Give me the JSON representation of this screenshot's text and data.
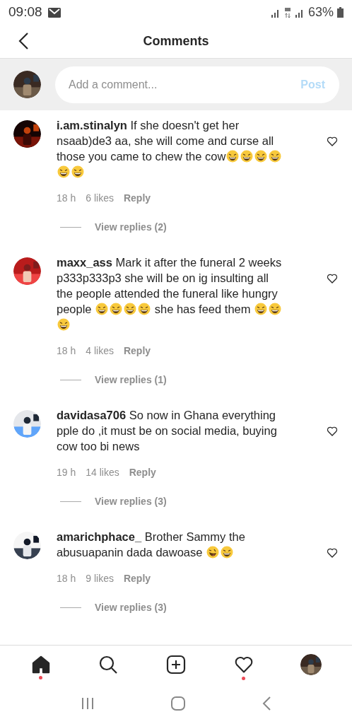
{
  "status_bar": {
    "time": "09:08",
    "battery": "63%"
  },
  "header": {
    "title": "Comments"
  },
  "composer": {
    "placeholder": "Add a comment...",
    "post": "Post",
    "disabled": true
  },
  "comments": [
    {
      "user": "i.am.stinalyn",
      "liked": false,
      "body": [
        {
          "kind": "text",
          "text": "If she doesn't get her nsaab)de3 aa, she will come and curse all those you came to chew the cow"
        },
        {
          "kind": "laugh"
        },
        {
          "kind": "laugh"
        },
        {
          "kind": "laugh"
        },
        {
          "kind": "laugh"
        },
        {
          "kind": "laugh"
        },
        {
          "kind": "laugh"
        }
      ],
      "time": "18 h",
      "likes": "6 likes",
      "reply": "Reply",
      "view_replies": "View replies (2)"
    },
    {
      "user": "maxx_ass",
      "liked": false,
      "body": [
        {
          "kind": "text",
          "text": "Mark it after the funeral 2 weeks p333p333p3 she will be on ig insulting all the people attended the funeral like hungry people "
        },
        {
          "kind": "laugh"
        },
        {
          "kind": "laugh"
        },
        {
          "kind": "laugh"
        },
        {
          "kind": "laugh"
        },
        {
          "kind": "text",
          "text": " she has feed them "
        },
        {
          "kind": "laugh"
        },
        {
          "kind": "laugh"
        },
        {
          "kind": "laugh"
        }
      ],
      "time": "18 h",
      "likes": "4 likes",
      "reply": "Reply",
      "view_replies": "View replies (1)"
    },
    {
      "user": "davidasa706",
      "liked": false,
      "body": [
        {
          "kind": "text",
          "text": "So now in Ghana everything pple do ,it must be on social media, buying cow too bi news"
        }
      ],
      "time": "19 h",
      "likes": "14 likes",
      "reply": "Reply",
      "view_replies": "View replies (3)"
    },
    {
      "user": "amarichphace_",
      "liked": false,
      "body": [
        {
          "kind": "text",
          "text": "Brother Sammy the abusuapanin dada dawoase "
        },
        {
          "kind": "wink"
        },
        {
          "kind": "laugh"
        }
      ],
      "time": "18 h",
      "likes": "9 likes",
      "reply": "Reply",
      "view_replies": "View replies (3)"
    }
  ],
  "tab_bar": [
    {
      "kind": "home",
      "selected": true,
      "badge": true
    },
    {
      "kind": "search",
      "selected": false,
      "badge": false
    },
    {
      "kind": "add",
      "selected": false,
      "badge": false
    },
    {
      "kind": "activity",
      "selected": false,
      "badge": true
    },
    {
      "kind": "profile",
      "selected": false,
      "badge": false
    }
  ]
}
